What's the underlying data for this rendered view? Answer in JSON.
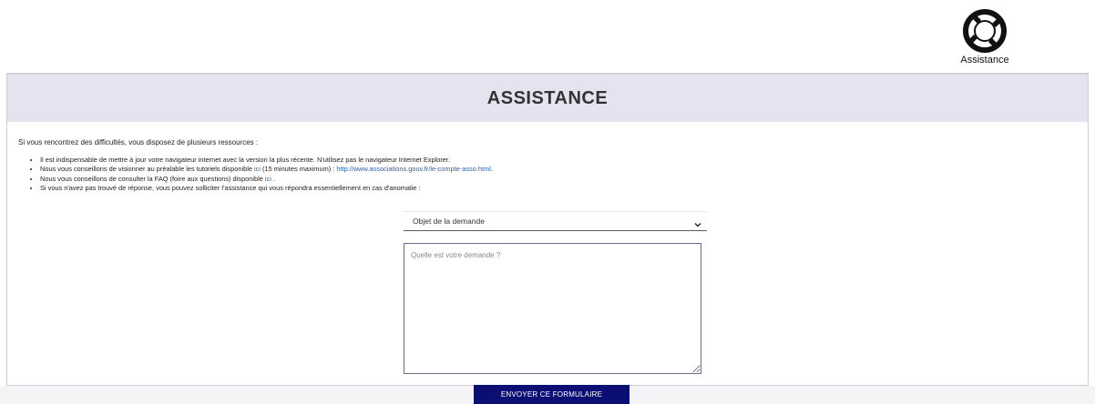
{
  "assistance_widget": {
    "label": "Assistance",
    "icon": "lifebuoy-icon"
  },
  "panel": {
    "title": "ASSISTANCE",
    "intro": "Si vous rencontrez des difficultés, vous disposez de plusieurs ressources :",
    "bullets": [
      {
        "text": "Il est indispensable de mettre à jour votre navigateur internet avec la version la plus récente. N'utilisez pas le navigateur Internet Explorer."
      },
      {
        "text_before": "Nous vous conseillons de visionner au préalable les tutoriels disponible ",
        "link1": "ici",
        "text_middle": " (15 minutes maximum) : ",
        "link2": "http://www.associations.gouv.fr/le-compte-asso.html",
        "text_after": "."
      },
      {
        "text_before": "Nous vous conseillons de consulter la FAQ (foire aux questions) disponible ",
        "link": "ici",
        "text_after": " ."
      },
      {
        "text": "Si vous n'avez pas trouvé de réponse, vous pouvez solliciter l'assistance qui vous répondra essentiellement en cas d'anomalie :"
      }
    ]
  },
  "form": {
    "select_value": "Objet de la demande",
    "textarea_placeholder": "Quelle est votre demande ?",
    "submit_label": "ENVOYER CE FORMULAIRE"
  },
  "colors": {
    "header_bg": "#e4e4f0",
    "button_bg": "#0b0f74",
    "link": "#2c5fa8"
  }
}
